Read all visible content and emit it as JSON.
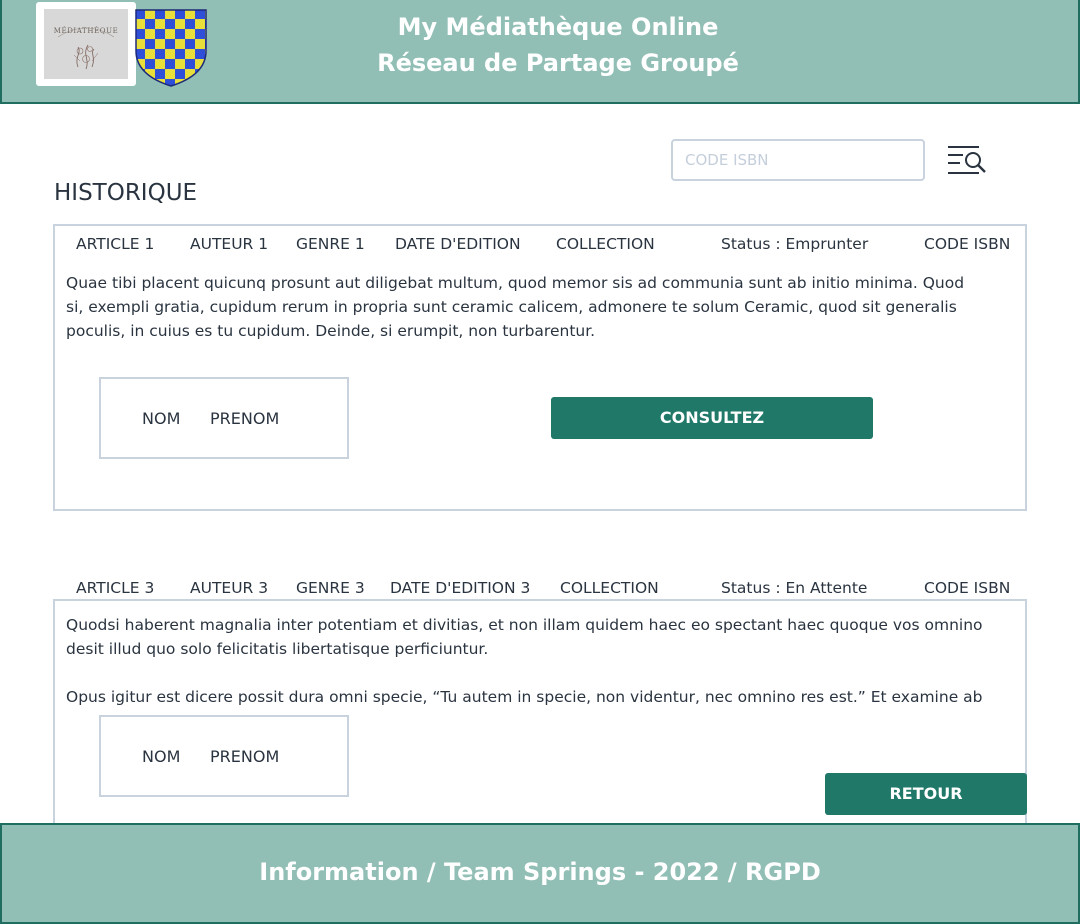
{
  "header": {
    "logo_text": "MÉDIATHÈQUE",
    "title_line1": "My Médiathèque Online",
    "title_line2": "Réseau de Partage Groupé"
  },
  "search": {
    "placeholder": "CODE ISBN",
    "icon": "search-list-icon"
  },
  "page_title": "HISTORIQUE",
  "records": [
    {
      "article": "ARTICLE 1",
      "auteur": "AUTEUR 1",
      "genre": "GENRE 1",
      "date_edition": "DATE D'EDITION",
      "collection": "COLLECTION",
      "status": "Status : Emprunter",
      "isbn": "CODE ISBN",
      "description": "Quae tibi placent quicunq prosunt aut diligebat multum, quod memor sis ad communia sunt ab initio minima. Quod si, exempli gratia, cupidum rerum in propria sunt ceramic calicem, admonere te solum Ceramic, quod sit generalis poculis, in cuius es tu cupidum. Deinde, si erumpit, non turbarentur.",
      "user_nom": "NOM",
      "user_prenom": "PRENOM",
      "action_label": "CONSULTEZ"
    },
    {
      "article": "ARTICLE 3",
      "auteur": "AUTEUR 3",
      "genre": "GENRE 3",
      "date_edition": "DATE D'EDITION 3",
      "collection": "COLLECTION",
      "status": "Status : En Attente",
      "isbn": "CODE ISBN",
      "description_p1": "Quodsi haberent magnalia inter potentiam et divitias, et non illam quidem haec eo spectant haec quoque vos omnino desit illud quo solo felicitatis libertatisque perficiuntur.",
      "description_p2": "Opus igitur est dicere possit dura omni specie, “Tu autem in specie, non videntur, nec omnino res est.” Et examine ab",
      "user_nom": "NOM",
      "user_prenom": "PRENOM",
      "action_label": "RETOUR"
    }
  ],
  "footer": {
    "text": "Information / Team Springs - 2022 / RGPD"
  },
  "colors": {
    "header_bg": "#92bfb5",
    "header_border": "#1f6e60",
    "button_bg": "#1f7868",
    "border": "#c9d3de"
  }
}
